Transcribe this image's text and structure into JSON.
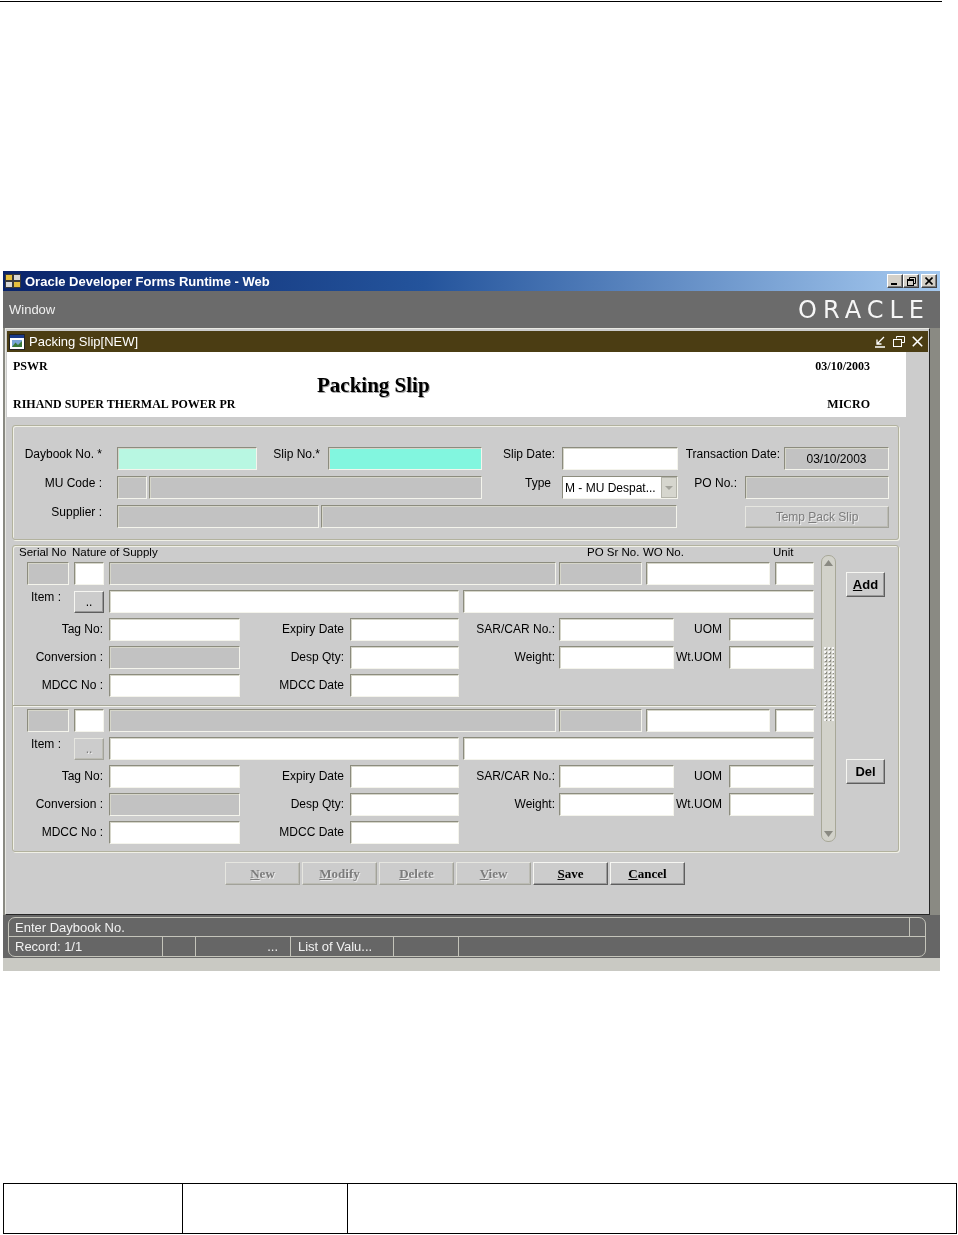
{
  "window": {
    "title": "Oracle Developer Forms Runtime - Web",
    "menu": [
      {
        "label": "Window"
      }
    ],
    "logo": "ORACLE"
  },
  "form_window": {
    "title": "Packing Slip[NEW]"
  },
  "header": {
    "code": "PSWR",
    "date": "03/10/2003",
    "title": "Packing Slip",
    "organisation": "RIHAND SUPER THERMAL POWER PR",
    "unit": "MICRO"
  },
  "master": {
    "daybook_no": {
      "label": "Daybook No. *",
      "kind": "current"
    },
    "slip_no": {
      "label": "Slip No.*",
      "kind": "required"
    },
    "slip_date": {
      "label": "Slip Date:",
      "kind": "text"
    },
    "transaction_date": {
      "label": "Transaction Date:",
      "kind": "readonly",
      "value": "03/10/2003"
    },
    "mu_code": {
      "label": "MU Code :",
      "kind": "readonly"
    },
    "type": {
      "label": "Type",
      "kind": "select",
      "value": "M - MU Despat..."
    },
    "po_no": {
      "label": "PO No.:",
      "kind": "readonly"
    },
    "supplier": {
      "label": "Supplier :",
      "kind": "readonly"
    },
    "temp_pack_slip": {
      "lead": "Temp ",
      "key": "P",
      "rest": "ack Slip",
      "disabled": true
    }
  },
  "lines": {
    "headers": [
      "Serial No",
      "Nature of Supply",
      "PO Sr No.",
      "WO No.",
      "Unit"
    ],
    "records": [
      {
        "cells": [
          {
            "kind": "readonly"
          },
          {
            "kind": "text"
          },
          {
            "kind": "readonly"
          },
          {
            "kind": "readonly"
          },
          {
            "kind": "text"
          },
          {
            "kind": "text"
          }
        ],
        "item_label": "Item :",
        "lookup": {
          "label": "..",
          "disabled": false
        },
        "item_fields": [
          {
            "kind": "text"
          },
          {
            "kind": "text"
          }
        ],
        "fields": [
          {
            "label": "Tag No:",
            "kind": "text"
          },
          {
            "label": "Expiry Date",
            "kind": "text"
          },
          {
            "label": "SAR/CAR No.:",
            "kind": "text"
          },
          {
            "label": "UOM",
            "kind": "text"
          },
          {
            "label": "Conversion :",
            "kind": "readonly"
          },
          {
            "label": "Desp Qty:",
            "kind": "text"
          },
          {
            "label": "Weight:",
            "kind": "text"
          },
          {
            "label": "Wt.UOM",
            "kind": "text"
          },
          {
            "label": "MDCC No :",
            "kind": "text"
          },
          {
            "label": "MDCC Date",
            "kind": "text"
          }
        ]
      },
      {
        "cells": [
          {
            "kind": "readonly"
          },
          {
            "kind": "text"
          },
          {
            "kind": "readonly"
          },
          {
            "kind": "readonly"
          },
          {
            "kind": "text"
          },
          {
            "kind": "text"
          }
        ],
        "item_label": "Item :",
        "lookup": {
          "label": "..",
          "disabled": true
        },
        "item_fields": [
          {
            "kind": "text"
          },
          {
            "kind": "text"
          }
        ],
        "fields": [
          {
            "label": "Tag No:",
            "kind": "text"
          },
          {
            "label": "Expiry Date",
            "kind": "text"
          },
          {
            "label": "SAR/CAR No.:",
            "kind": "text"
          },
          {
            "label": "UOM",
            "kind": "text"
          },
          {
            "label": "Conversion :",
            "kind": "readonly"
          },
          {
            "label": "Desp Qty:",
            "kind": "text"
          },
          {
            "label": "Weight:",
            "kind": "text"
          },
          {
            "label": "Wt.UOM",
            "kind": "text"
          },
          {
            "label": "MDCC No :",
            "kind": "text"
          },
          {
            "label": "MDCC Date",
            "kind": "text"
          }
        ]
      }
    ],
    "buttons": [
      {
        "key": "A",
        "rest": "dd",
        "disabled": false
      },
      {
        "lead": "Del",
        "disabled": false
      }
    ]
  },
  "actions": [
    {
      "key": "N",
      "rest": "ew",
      "disabled": true
    },
    {
      "key": "M",
      "rest": "odify",
      "disabled": true
    },
    {
      "key": "D",
      "rest": "elete",
      "disabled": true
    },
    {
      "key": "V",
      "rest": "iew",
      "disabled": true
    },
    {
      "key": "S",
      "rest": "ave",
      "disabled": false
    },
    {
      "key": "C",
      "rest": "ancel",
      "disabled": false
    }
  ],
  "status_bar": {
    "message": "Enter Daybook No.",
    "record": "Record: 1/1",
    "indicator": "...",
    "lov": "List of Valu..."
  }
}
